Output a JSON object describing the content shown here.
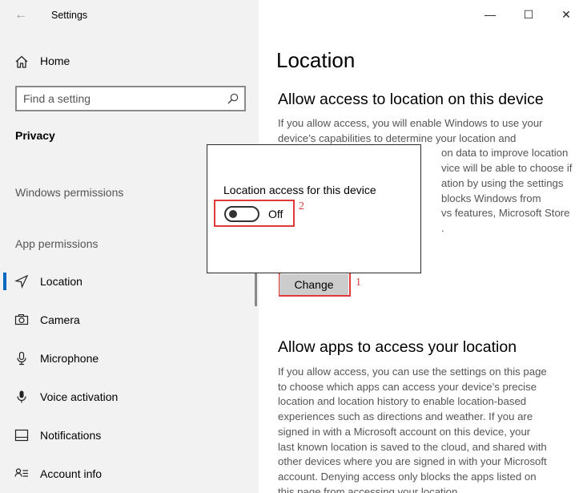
{
  "window": {
    "title": "Settings",
    "minimize_glyph": "—",
    "maximize_glyph": "☐",
    "close_glyph": "✕",
    "back_glyph": "←"
  },
  "sidebar": {
    "home_label": "Home",
    "search_placeholder": "Find a setting",
    "section_title": "Privacy",
    "windows_permissions_label": "Windows permissions",
    "app_permissions_label": "App permissions",
    "items": [
      {
        "label": "Location",
        "icon": "location-icon",
        "active": true
      },
      {
        "label": "Camera",
        "icon": "camera-icon",
        "active": false
      },
      {
        "label": "Microphone",
        "icon": "microphone-icon",
        "active": false
      },
      {
        "label": "Voice activation",
        "icon": "voice-activation-icon",
        "active": false
      },
      {
        "label": "Notifications",
        "icon": "notifications-icon",
        "active": false
      },
      {
        "label": "Account info",
        "icon": "account-info-icon",
        "active": false
      }
    ]
  },
  "main": {
    "title": "Location",
    "section1": {
      "heading": "Allow access to location on this device",
      "lines": [
        "If you allow access, you will enable Windows to use your",
        "device’s capabilities to determine your location and",
        "on data to improve location",
        "vice will be able to choose if",
        "ation by using the settings",
        "blocks Windows from",
        "vs features, Microsoft Store",
        "."
      ],
      "change_button": "Change"
    },
    "section2": {
      "heading": "Allow apps to access your location",
      "lines": [
        "If you allow access, you can use the settings on this page",
        "to choose which apps can access your device’s precise",
        "location and location history to enable location-based",
        "experiences such as directions and weather. If you are",
        "signed in with a Microsoft account on this device, your",
        "last known location is saved to the cloud, and shared with",
        "other devices where you are signed in with your Microsoft",
        "account. Denying access only blocks the apps listed on",
        "this page from accessing your location."
      ]
    }
  },
  "dialog": {
    "label": "Location access for this device",
    "toggle_state": "Off"
  },
  "annotations": {
    "step1": "1",
    "step2": "2",
    "highlight_color": "#e03a3a"
  },
  "colors": {
    "accent": "#0067c0",
    "sidebar_bg": "#f2f2f2"
  }
}
